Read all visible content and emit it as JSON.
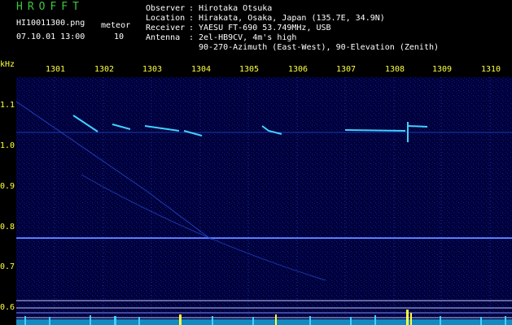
{
  "header": {
    "brand": "HROFFT",
    "filename": "HI10011300.png",
    "datetime": "07.10.01 13:00",
    "mode_label": "meteor",
    "count": "10"
  },
  "info": {
    "observer_label": "Observer",
    "observer_value": "Hirotaka Otsuka",
    "location_label": "Location",
    "location_value": "Hirakata, Osaka, Japan (135.7E, 34.9N)",
    "receiver_label": "Receiver",
    "receiver_value": "YAESU FT-690 53.749MHz, USB",
    "antenna_label": "Antenna",
    "antenna_value": "2el-HB9CV, 4m's high",
    "antenna_value2": "90-270-Azimuth (East-West), 90-Elevation (Zenith)"
  },
  "axis": {
    "unit": "kHz",
    "time_labels": [
      "1301",
      "1302",
      "1303",
      "1304",
      "1305",
      "1306",
      "1307",
      "1308",
      "1309",
      "1310"
    ],
    "freq_labels": [
      "1.1",
      "1.0",
      "0.9",
      "0.8",
      "0.7",
      "0.6"
    ]
  },
  "colors": {
    "background": "#000000",
    "plot": "#00003a",
    "brand": "#3cc83c",
    "axis": "#ffff40",
    "trace": "#40d0ff"
  }
}
